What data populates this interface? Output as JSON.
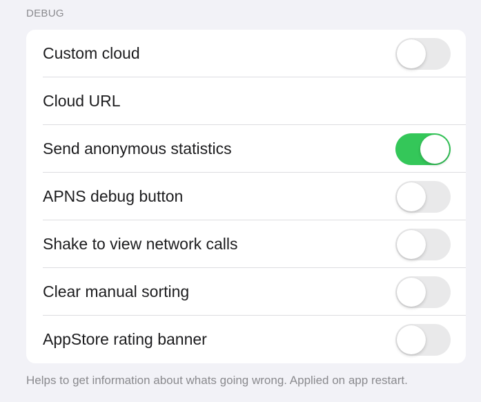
{
  "section": {
    "header": "DEBUG",
    "footer": "Helps to get information about whats going wrong. Applied on app restart."
  },
  "rows": [
    {
      "label": "Custom cloud",
      "has_toggle": true,
      "on": false
    },
    {
      "label": "Cloud URL",
      "has_toggle": false
    },
    {
      "label": "Send anonymous statistics",
      "has_toggle": true,
      "on": true
    },
    {
      "label": "APNS debug button",
      "has_toggle": true,
      "on": false
    },
    {
      "label": "Shake to view network calls",
      "has_toggle": true,
      "on": false
    },
    {
      "label": "Clear manual sorting",
      "has_toggle": true,
      "on": false
    },
    {
      "label": "AppStore rating banner",
      "has_toggle": true,
      "on": false
    }
  ],
  "colors": {
    "background": "#f2f2f7",
    "toggle_on": "#34c759",
    "toggle_off": "#e9e9ea",
    "secondary_text": "#8a8a8e"
  }
}
